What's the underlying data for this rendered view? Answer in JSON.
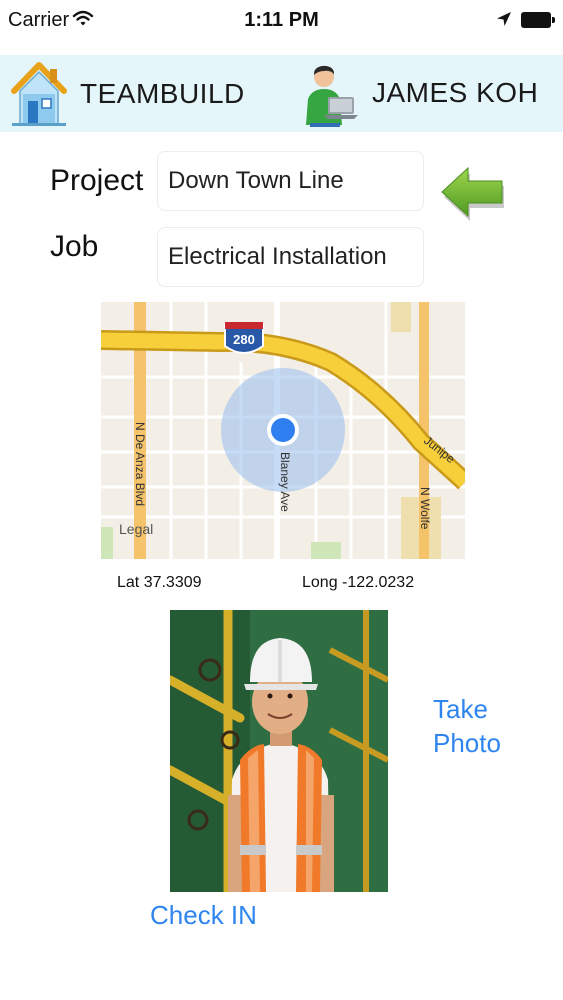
{
  "status_bar": {
    "carrier": "Carrier",
    "time": "1:11 PM"
  },
  "header": {
    "app_title": "TEAMBUILD",
    "user_name": "JAMES KOH",
    "background_color": "#e4f6fa"
  },
  "form": {
    "project_label": "Project",
    "project_value": "Down Town Line",
    "job_label": "Job",
    "job_value": "Electrical Installation"
  },
  "map": {
    "legal_label": "Legal",
    "shield_number": "280",
    "street_labels": [
      "N De Anza Blvd",
      "Blaney Ave",
      "N Wolfe",
      "Junipe"
    ]
  },
  "location": {
    "lat_text": "Lat 37.3309",
    "long_text": "Long -122.0232"
  },
  "actions": {
    "take_photo_line1": "Take",
    "take_photo_line2": "Photo",
    "check_in_label": "Check IN",
    "link_color": "#2f85ef"
  },
  "icons": {
    "house": "house-icon",
    "avatar": "avatar",
    "back": "back-arrow-icon",
    "wifi": "wifi-icon",
    "location": "location-arrow-icon",
    "battery": "battery-icon"
  }
}
